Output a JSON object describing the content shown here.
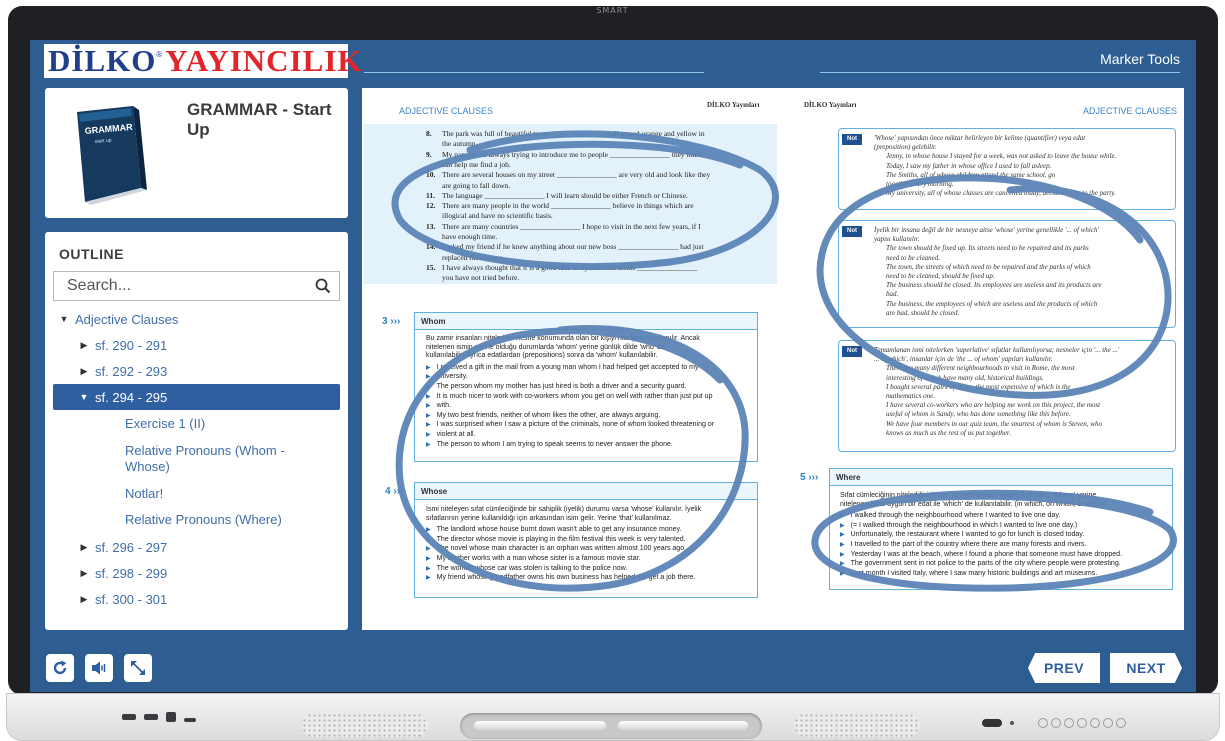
{
  "device": {
    "brand": "SMART"
  },
  "header": {
    "logo_part1": "DİLKO",
    "logo_reg": "®",
    "logo_part2": "YAYINCILIK",
    "marker_tools_label": "Marker Tools"
  },
  "book": {
    "title": "GRAMMAR - Start Up",
    "cover_title": "GRAMMAR",
    "cover_subtitle": "start up"
  },
  "outline": {
    "title": "OUTLINE",
    "search_placeholder": "Search...",
    "items": [
      {
        "label": "Adjective Clauses",
        "caret": "▼"
      },
      {
        "label": "sf. 290 - 291",
        "caret": "▶"
      },
      {
        "label": "sf. 292 - 293",
        "caret": "▶"
      },
      {
        "label": "sf. 294 - 295",
        "caret": "▼"
      },
      {
        "label": "sf. 296 - 297",
        "caret": "▶"
      },
      {
        "label": "sf. 298 - 299",
        "caret": "▶"
      },
      {
        "label": "sf. 300 - 301",
        "caret": "▶"
      }
    ],
    "subitems": [
      "Exercise 1 (II)",
      "Relative Pronouns (Whom - Whose)",
      "Notlar!",
      "Relative Pronouns (Where)"
    ]
  },
  "document": {
    "header_left": "ADJECTIVE CLAUSES",
    "header_right": "ADJECTIVE CLAUSES",
    "publisher_left": "DİLKO Yayınları",
    "publisher_right": "DİLKO Yayınları",
    "exercise_lines": [
      {
        "n": "8.",
        "t": "The park was full of beautiful trees ________________ all turned orange and yellow in"
      },
      {
        "n": "",
        "t": "the autumn."
      },
      {
        "n": "9.",
        "t": "My parents are always trying to introduce me to people ________________ they think"
      },
      {
        "n": "",
        "t": "can help me find a job."
      },
      {
        "n": "10.",
        "t": "There are several houses on my street ________________ are very old and look like they"
      },
      {
        "n": "",
        "t": "are going to fall down."
      },
      {
        "n": "11.",
        "t": "The language ________________ I will learn should be either French or Chinese."
      },
      {
        "n": "12.",
        "t": "There are many people in the world ________________ believe in things which are"
      },
      {
        "n": "",
        "t": "illogical and have no scientific basis."
      },
      {
        "n": "13.",
        "t": "There are many countries ________________ I hope to visit in the next few years, if I"
      },
      {
        "n": "",
        "t": "have enough time."
      },
      {
        "n": "14.",
        "t": "I asked my friend if he knew anything about our new boss ________________ had just"
      },
      {
        "n": "",
        "t": "replaced the old one."
      },
      {
        "n": "15.",
        "t": "I have always thought that it is a good idea to try different meals ________________"
      },
      {
        "n": "",
        "t": "you have not tried before."
      }
    ],
    "section3": {
      "num": "3",
      "title": "Whom",
      "intro": [
        "Bu zamir insanları nitelerken nesne konumunda olan bir kişiyi niteliyorsa kullanılır. Ancak",
        "nitelenen ismin nesne olduğu durumlarda 'whom' yerine günlük dilde 'who' da",
        "kullanılabilir. Ayrıca edatlardan (prepositions) sonra da 'whom' kullanılabilir."
      ],
      "bullets": [
        "I received a gift in the mail from a young man whom I had helped get accepted to my",
        "university.",
        "The person whom my mother has just hired is both a driver and a security guard.",
        "It is much nicer to work with co-workers whom you get on well with rather than just put up",
        "with.",
        "My two best friends, neither of whom likes the other, are always arguing.",
        "I was surprised when I saw a picture of the criminals, none of whom looked threatening or",
        "violent at all.",
        "The person to whom I am trying to speak seems to never answer the phone."
      ]
    },
    "section4": {
      "num": "4",
      "title": "Whose",
      "intro": [
        "İsmi niteleyen sıfat cümleciğinde bir sahiplik (iyelik) durumu varsa 'whose' kullanılır. İyelik",
        "sıfatlarının yerine kullanıldığı için arkasından isim gelir. Yerine 'that' kullanılmaz."
      ],
      "bullets": [
        "The landlord whose house burnt down wasn't able to get any insurance money.",
        "The director whose movie is playing in the film festival this week is very talented.",
        "The novel whose main character is an orphan was written almost 100 years ago.",
        "My brother works with a man whose sister is a famous movie star.",
        "The woman whose car was stolen is talking to the police now.",
        "My friend whose grandfather owns his own business has helped me get a job there."
      ]
    },
    "section5": {
      "num": "5",
      "title": "Where",
      "intro": [
        "Sıfat cümleciğinin nitelediği isim bir yer belirtiyorsa 'where' kullanırız. 'where' yerine",
        "nitelenen isme uygun bir edat ile 'which' de kullanılabilir. (in which, on which, at which)"
      ],
      "bullets": [
        "I walked through the neighbourhood where I wanted to live one day.",
        "(= I walked through the neighbourhood in which I wanted to live one day.)",
        "Unfortunately, the restaurant where I wanted to go for lunch is closed today.",
        "I travelled to the part of the country where there are many forests and rivers.",
        "Yesterday I was at the beach, where I found a phone that someone must have dropped.",
        "The government sent in riot police to the parts of the city where people were protesting.",
        "Last month I visited Italy, where I saw many historic buildings and art museums."
      ]
    },
    "note_tag": "Not",
    "note1": [
      "'Whose' yapısından önce miktar belirleyen bir kelime (quantifier) veya edat",
      "(preposition) gelebilir.",
      "Jenny, in whose house I stayed for a week, was not asked to leave the house while.",
      "Today, I saw my father in whose office I used to fall asleep.",
      "The Smiths, all of whose children attend the same school, go",
      "together every morning.",
      "My university, all of whose classes are cancelled today, decided to go to the party."
    ],
    "note2": [
      "İyelik bir insana değil de bir nesneye aitse 'whose' yerine genellikle '... of which'",
      "yapısı kullanılır.",
      "The town should be fixed up. Its streets need to be repaired and its parks",
      "need to be cleaned.",
      "The town, the streets of which need to be repaired and the parks of which",
      "need to be cleaned, should be fixed up.",
      "The business should be closed. Its employees are useless and its products are",
      "bad.",
      "The business, the employees of which are useless and the products of which",
      "are bad, should be closed."
    ],
    "note3": [
      "Tamamlanan ismi nitelerken 'superlative' sıfatlar kullanılıyorsa; nesneler için '... the ...'",
      "... of which', insanlar için de 'the ... of whom' yapıları kullanılır.",
      "There are many different neighbourhoods to visit in Rome, the most",
      "interesting of which have many old, historical buildings.",
      "I bought several pairs of shoes, the most expensive of which is the",
      "mathematics one.",
      "I have several co-workers who are helping me work on this project, the most",
      "useful of whom is Sandy, who has done something like this before.",
      "We have four members in our quiz team, the smartest of whom is Steven, who",
      "knows as much as the rest of us put together."
    ]
  },
  "toolbar": {
    "prev_label": "PREV",
    "next_label": "NEXT"
  },
  "colors": {
    "app_blue": "#2e5e91",
    "selected_row": "#2f5fa1",
    "logo_blue": "#1f3f8c",
    "logo_red": "#e1252a",
    "marker": "#5b84b6"
  }
}
